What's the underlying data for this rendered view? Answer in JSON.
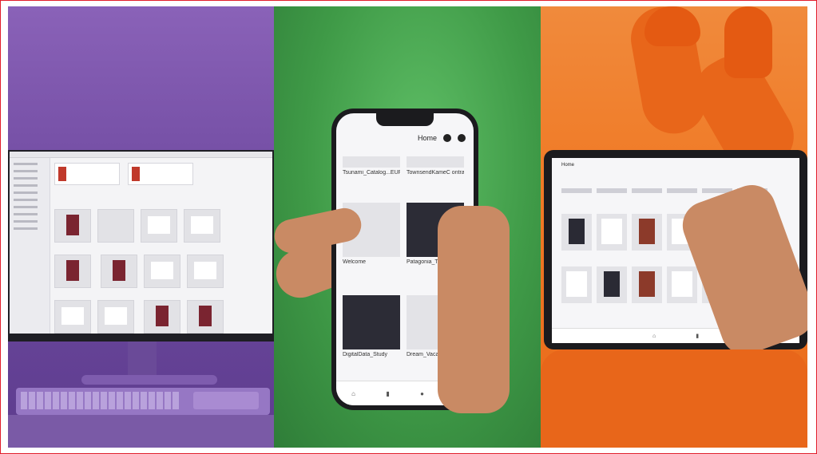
{
  "colors": {
    "border": "#e11d2a",
    "desktop_bg": "#6f4aa0",
    "phone_bg": "#3f9a47",
    "tablet_bg": "#f07a26",
    "fab": "#1e6fe8"
  },
  "phone": {
    "header": "Home",
    "items": [
      {
        "name": "Tsunami_Catalog...EUPDF"
      },
      {
        "name": "TownsendKameC ontract...EUPDF"
      },
      {
        "name": "Welcome"
      },
      {
        "name": "Patagonia_Trifold"
      },
      {
        "name": "DigitalData_Study"
      },
      {
        "name": "Dream_Vacation"
      }
    ],
    "fab_icon": "plus-icon",
    "nav": [
      "home-icon",
      "files-icon",
      "shared-icon",
      "search-icon"
    ]
  },
  "tablet": {
    "header": "Home",
    "nav": [
      "home-icon",
      "files-icon"
    ]
  }
}
